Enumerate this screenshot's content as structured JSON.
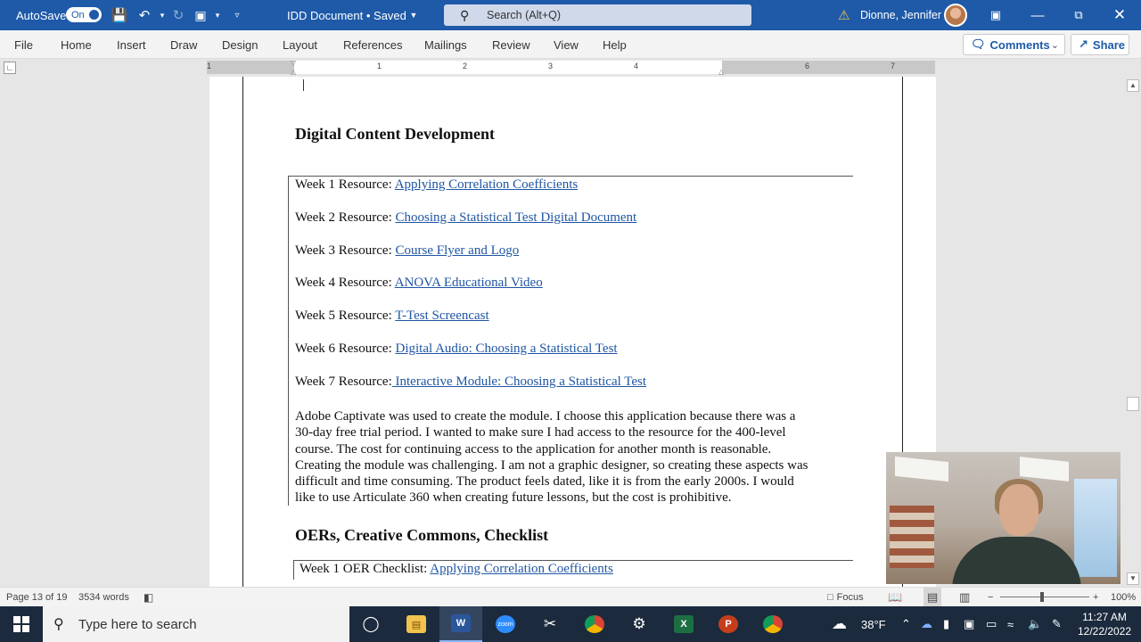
{
  "titlebar": {
    "autosave_label": "AutoSave",
    "autosave_state": "On",
    "doc_title": "IDD Document • Saved",
    "search_placeholder": "Search (Alt+Q)",
    "user_name": "Dionne, Jennifer"
  },
  "menu": {
    "tabs": [
      "File",
      "Home",
      "Insert",
      "Draw",
      "Design",
      "Layout",
      "References",
      "Mailings",
      "Review",
      "View",
      "Help"
    ],
    "comments_label": "Comments",
    "share_label": "Share"
  },
  "ruler": {
    "numbers": [
      "1",
      "1",
      "2",
      "3",
      "4",
      "6",
      "7"
    ]
  },
  "document": {
    "heading1": "Digital Content Development",
    "resources": [
      {
        "label": "Week 1 Resource: ",
        "link": "Applying Correlation Coefficients"
      },
      {
        "label": "Week 2 Resource: ",
        "link": "Choosing a Statistical Test Digital Document"
      },
      {
        "label": "Week 3 Resource: ",
        "link": "Course Flyer and Logo"
      },
      {
        "label": "Week 4 Resource: ",
        "link": "ANOVA Educational Video"
      },
      {
        "label": "Week 5 Resource: ",
        "link": "T-Test Screencast"
      },
      {
        "label": "Week 6 Resource: ",
        "link": "Digital Audio: Choosing a Statistical Test"
      },
      {
        "label": "Week 7 Resource:",
        "link": " Interactive Module: Choosing a Statistical Test"
      }
    ],
    "paragraph_lines": [
      "Adobe Captivate was used to create the module. I choose this application because there was a",
      "30-day free trial period. I wanted to make sure I had access to the resource for the 400-level",
      "course. The cost for continuing access to the application for another month is reasonable.",
      "Creating the module was challenging. I am not a graphic designer, so creating these aspects was",
      "difficult and time consuming. The product feels dated, like it is from the early 2000s. I would",
      "like to use Articulate 360 when creating future lessons, but the cost is prohibitive."
    ],
    "heading2": "OERs, Creative Commons, Checklist",
    "checklist": {
      "label": "Week 1 OER Checklist: ",
      "link": "Applying Correlation Coefficients"
    }
  },
  "statusbar": {
    "page": "Page 13 of 19",
    "words": "3534 words",
    "focus": "Focus",
    "zoom": "100%",
    "zoom_fraction": 0.47
  },
  "taskbar": {
    "search_placeholder": "Type here to search",
    "zoom_app_label": "zoom",
    "weather": "38°F",
    "time": "11:27 AM",
    "date": "12/22/2022"
  },
  "colors": {
    "titlebar": "#1e5aa8",
    "hyperlink": "#1f56a3",
    "taskbar": "#1c2a3d"
  }
}
